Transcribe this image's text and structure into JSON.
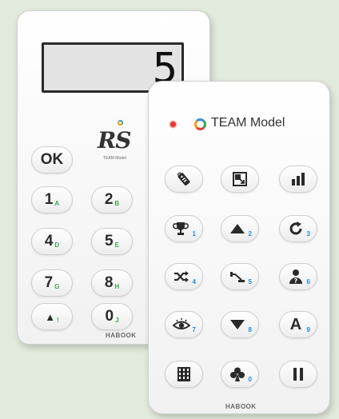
{
  "back_remote": {
    "display_value": "5",
    "logo_text": "RS",
    "logo_sub": "TEAM Model",
    "keys": [
      {
        "main": "OK",
        "sub": ""
      },
      {
        "main": "1",
        "sub": "A"
      },
      {
        "main": "2",
        "sub": "B"
      },
      {
        "main": "4",
        "sub": "D"
      },
      {
        "main": "5",
        "sub": "E"
      },
      {
        "main": "7",
        "sub": "G"
      },
      {
        "main": "8",
        "sub": "H"
      },
      {
        "main": "▲",
        "sub": "!"
      },
      {
        "main": "0",
        "sub": "J"
      }
    ],
    "brand": "HABOOK"
  },
  "front_remote": {
    "title": "TEAM Model",
    "buttons": [
      {
        "icon": "remote-icon",
        "sub": ""
      },
      {
        "icon": "resize-icon",
        "sub": ""
      },
      {
        "icon": "bar-chart-icon",
        "sub": ""
      },
      {
        "icon": "trophy-icon",
        "sub": "1"
      },
      {
        "icon": "up-arrow-icon",
        "sub": "2"
      },
      {
        "icon": "refresh-icon",
        "sub": "3"
      },
      {
        "icon": "shuffle-icon",
        "sub": "4"
      },
      {
        "icon": "pick-icon",
        "sub": "5"
      },
      {
        "icon": "question-person-icon",
        "sub": "6"
      },
      {
        "icon": "eye-icon",
        "sub": "7"
      },
      {
        "icon": "down-arrow-icon",
        "sub": "8"
      },
      {
        "icon": "letter-a-icon",
        "sub": "9",
        "text": "A"
      },
      {
        "icon": "grid-icon",
        "sub": ""
      },
      {
        "icon": "club-icon",
        "sub": "0"
      },
      {
        "icon": "pause-icon",
        "sub": ""
      }
    ],
    "brand": "HABOOK",
    "accent_color": "#1e88e5"
  }
}
